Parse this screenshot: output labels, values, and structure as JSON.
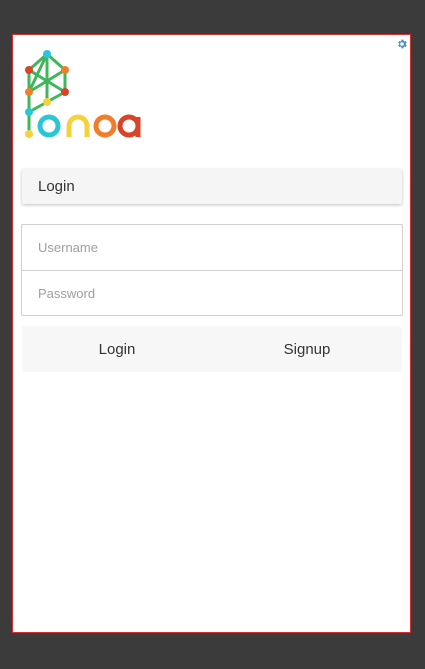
{
  "app": {
    "logo_text": "Fonoa",
    "settings_icon": "gear-icon"
  },
  "login_header": {
    "title": "Login"
  },
  "form": {
    "username_placeholder": "Username",
    "password_placeholder": "Password",
    "username_value": "",
    "password_value": ""
  },
  "actions": {
    "login_label": "Login",
    "signup_label": "Signup"
  },
  "colors": {
    "background": "#3b3b3b",
    "panel_border": "#d32f2f",
    "gear": "#4a90c8",
    "logo_yellow": "#f4d23c",
    "logo_cyan": "#29c6d8",
    "logo_orange": "#ef7d2a",
    "logo_red": "#d8432a",
    "logo_green": "#3fb65a"
  }
}
